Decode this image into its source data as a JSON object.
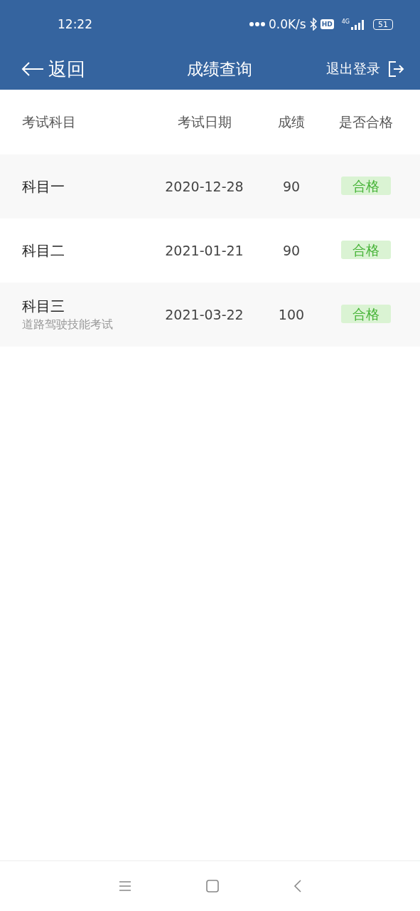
{
  "status_bar": {
    "time": "12:22",
    "net_speed": "0.0K/s",
    "hd_badge": "HD",
    "network_type": "4G",
    "battery": "51"
  },
  "nav_bar": {
    "back_label": "返回",
    "title": "成绩查询",
    "logout_label": "退出登录"
  },
  "table": {
    "columns": [
      "考试科目",
      "考试日期",
      "成绩",
      "是否合格"
    ],
    "rows": [
      {
        "subject": "科目一",
        "date": "2020-12-28",
        "score": "90",
        "result": "合格",
        "passed": true
      },
      {
        "subject": "科目二",
        "date": "2021-01-21",
        "score": "90",
        "result": "合格",
        "passed": true
      },
      {
        "subject": "科目三",
        "subtitle": "道路驾驶技能考试",
        "date": "2021-03-22",
        "score": "100",
        "result": "合格",
        "passed": true
      }
    ]
  }
}
